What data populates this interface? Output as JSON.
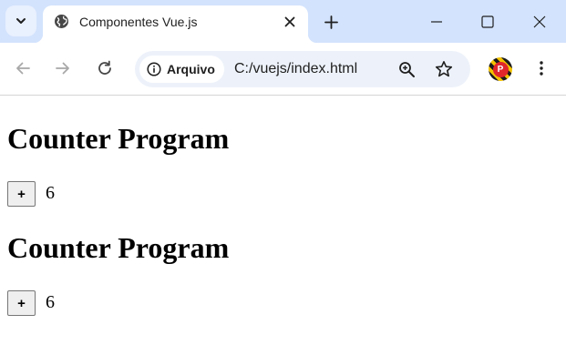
{
  "browser": {
    "tab": {
      "title": "Componentes Vue.js"
    },
    "address_bar": {
      "site_chip_label": "Arquivo",
      "url": "C:/vuejs/index.html"
    }
  },
  "counters": [
    {
      "heading": "Counter Program",
      "button_label": "+",
      "value": "6"
    },
    {
      "heading": "Counter Program",
      "button_label": "+",
      "value": "6"
    }
  ],
  "colors": {
    "tabbar_bg": "#d3e3fd",
    "omnibox_bg": "#edf2fa",
    "icon": "#474747"
  }
}
